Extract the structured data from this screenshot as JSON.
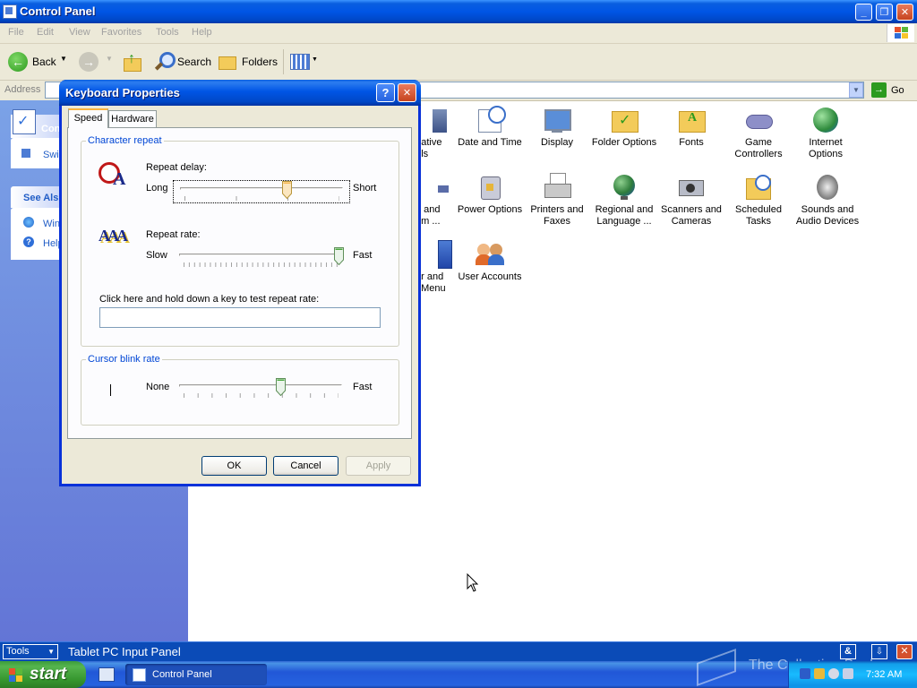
{
  "window": {
    "title": "Control Panel"
  },
  "menu": [
    "File",
    "Edit",
    "View",
    "Favorites",
    "Tools",
    "Help"
  ],
  "toolbar": {
    "back": "Back",
    "search": "Search",
    "folders": "Folders"
  },
  "address": {
    "label": "Address",
    "go": "Go"
  },
  "taskpane": {
    "panel1_title": "Cont",
    "switch_text": "Swi",
    "see_also_title": "See Als",
    "see_also_items": [
      "Win",
      "Help"
    ]
  },
  "icons": [
    [
      "strative\nools",
      "Date and Time",
      "Display",
      "Folder Options",
      "Fonts",
      "Game\nControllers",
      "Internet\nOptions"
    ],
    [
      "e and\nem ...",
      "Power Options",
      "Printers and\nFaxes",
      "Regional and\nLanguage ...",
      "Scanners and\nCameras",
      "Scheduled\nTasks",
      "Sounds and\nAudio Devices"
    ],
    [
      "ar and\nt Menu",
      "User Accounts"
    ]
  ],
  "dialog": {
    "title": "Keyboard Properties",
    "tabs": [
      "Speed",
      "Hardware"
    ],
    "char_repeat_title": "Character repeat",
    "repeat_delay_label": "Repeat delay:",
    "repeat_delay_left": "Long",
    "repeat_delay_right": "Short",
    "repeat_delay_value": 0.66,
    "repeat_rate_label": "Repeat rate:",
    "repeat_rate_left": "Slow",
    "repeat_rate_right": "Fast",
    "repeat_rate_value": 1.0,
    "test_label": "Click here and hold down a key to test repeat rate:",
    "test_value": "",
    "cursor_blink_title": "Cursor blink rate",
    "cursor_left": "None",
    "cursor_right": "Fast",
    "cursor_value": 0.63,
    "ok": "OK",
    "cancel": "Cancel",
    "apply": "Apply"
  },
  "tablet": {
    "tools": "Tools",
    "title": "Tablet PC Input Panel"
  },
  "taskbar": {
    "start": "start",
    "task": "Control Panel",
    "clock": "7:32 AM",
    "watermark": "The Collection Book"
  }
}
